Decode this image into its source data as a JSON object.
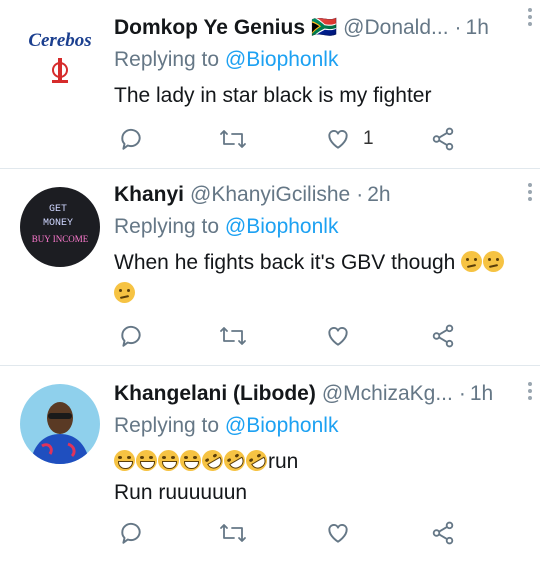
{
  "tweets": [
    {
      "name": "Domkop Ye Genius",
      "flag": "🇿🇦",
      "handle": "@Donald...",
      "time": "1h",
      "replying_prefix": "Replying to",
      "replying_handle": "@Biophonlk",
      "lines": [
        "The lady in star black is my fighter"
      ],
      "likes": "1",
      "avatar": {
        "text_1": "Cerebos",
        "colors": {
          "bg": "#ffffff",
          "text": "#1b3f8f",
          "accent": "#d62b2b"
        }
      }
    },
    {
      "name": "Khanyi",
      "handle": "@KhanyiGcilishe",
      "time": "2h",
      "replying_prefix": "Replying to",
      "replying_handle": "@Biophonlk",
      "lines": [
        "When he fights back it's GBV though"
      ],
      "emoji_line1": [
        "confused",
        "confused"
      ],
      "emoji_line2": [
        "confused"
      ],
      "avatar": {
        "text_1": "GET",
        "text_2": "MONEY",
        "text_3": "BUY INCOME",
        "colors": {
          "bg": "#1c1d22",
          "text": "#cfd6ff",
          "accent": "#ff7ad0"
        }
      }
    },
    {
      "name": "Khangelani (Libode)",
      "handle": "@MchizaKg...",
      "time": "1h",
      "replying_prefix": "Replying to",
      "replying_handle": "@Biophonlk",
      "emoji_line1": [
        "grin-sweat",
        "grin-sweat",
        "grin-sweat",
        "grin-sweat",
        "rofl",
        "rofl",
        "rofl"
      ],
      "emoji_suffix": "run",
      "lines": [
        "Run ruuuuuun"
      ],
      "avatar": {
        "colors": {
          "bg": "#8fd0ec",
          "shirt": "#1f4fbf",
          "skin": "#5a3a24"
        }
      }
    }
  ],
  "icons": {
    "reply": "reply-icon",
    "retweet": "retweet-icon",
    "like": "heart-icon",
    "share": "share-icon",
    "more": "more-icon"
  },
  "colors": {
    "text": "#14171a",
    "muted": "#657786",
    "link": "#1da1f2",
    "divider": "#e1e8ed",
    "icon": "#657786"
  }
}
